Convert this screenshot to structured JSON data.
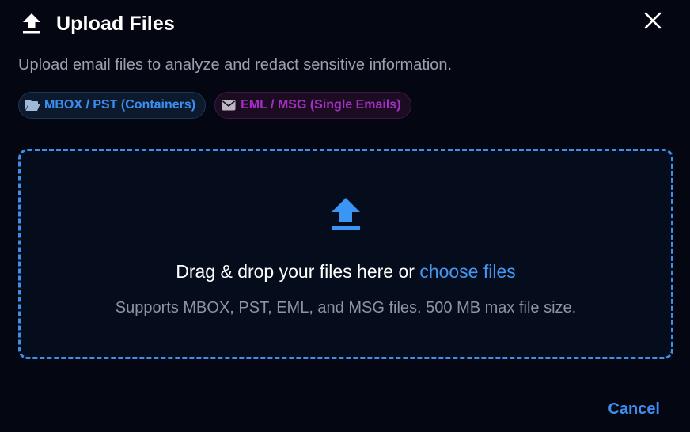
{
  "dialog": {
    "title": "Upload Files",
    "title_icon": "upload-icon",
    "close_icon": "close-icon",
    "subtitle": "Upload email files to analyze and redact sensitive information.",
    "chips": [
      {
        "label": "MBOX / PST (Containers)",
        "icon": "folder-open-icon",
        "color": "#3b8ff0"
      },
      {
        "label": "EML / MSG (Single Emails)",
        "icon": "envelope-icon",
        "color": "#a52fc4"
      }
    ],
    "dropzone": {
      "icon": "upload-icon",
      "text": "Drag & drop your files here or ",
      "link": "choose files",
      "hint": "Supports MBOX, PST, EML, and MSG files. 500 MB max file size."
    },
    "cancel_label": "Cancel"
  },
  "colors": {
    "background": "#040712",
    "accent": "#3f8fe8",
    "purple": "#a52fc4"
  }
}
